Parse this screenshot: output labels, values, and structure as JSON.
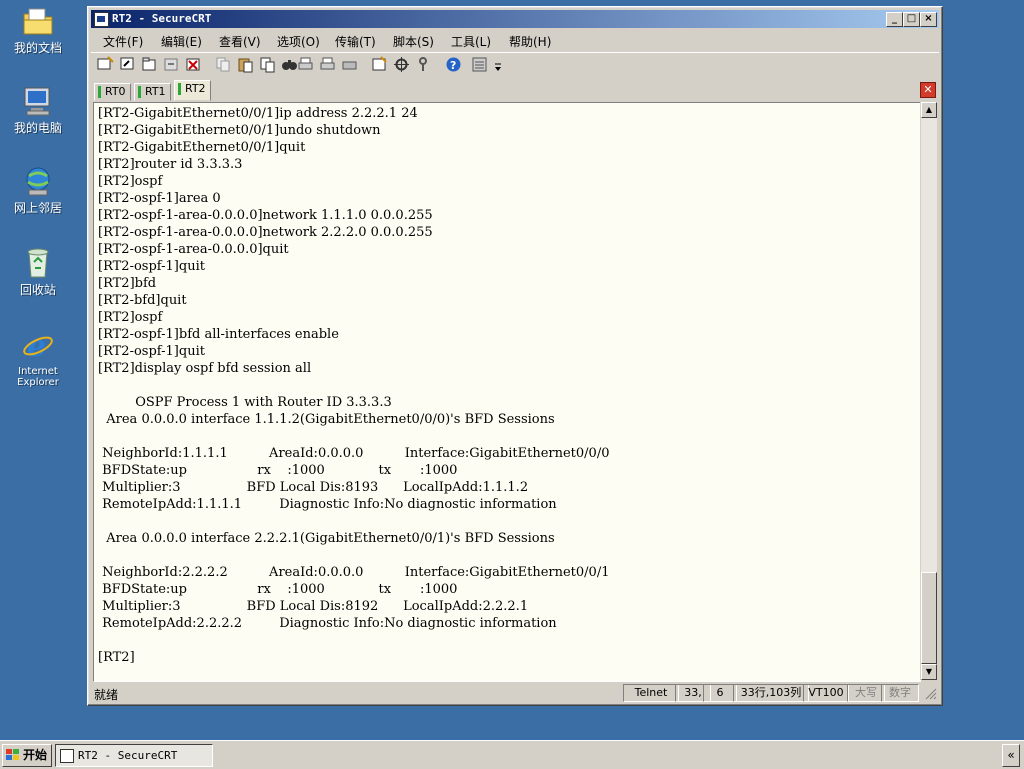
{
  "desktop": {
    "icons": [
      {
        "label": "我的文档",
        "icon": "my-documents-icon"
      },
      {
        "label": "我的电脑",
        "icon": "my-computer-icon"
      },
      {
        "label": "网上邻居",
        "icon": "network-places-icon"
      },
      {
        "label": "回收站",
        "icon": "recycle-bin-icon"
      },
      {
        "label": "Internet Explorer",
        "icon": "internet-explorer-icon"
      }
    ]
  },
  "window": {
    "title": "RT2 - SecureCRT",
    "controls": {
      "minimize": "_",
      "maximize": "□",
      "close": "×"
    }
  },
  "menu": [
    "文件(F)",
    "编辑(E)",
    "查看(V)",
    "选项(O)",
    "传输(T)",
    "脚本(S)",
    "工具(L)",
    "帮助(H)"
  ],
  "tabs": [
    {
      "label": "RT0",
      "active": false
    },
    {
      "label": "RT1",
      "active": false
    },
    {
      "label": "RT2",
      "active": true
    }
  ],
  "terminal": {
    "lines": [
      "[RT2-GigabitEthernet0/0/1]ip address 2.2.2.1 24",
      "[RT2-GigabitEthernet0/0/1]undo shutdown",
      "[RT2-GigabitEthernet0/0/1]quit",
      "[RT2]router id 3.3.3.3",
      "[RT2]ospf",
      "[RT2-ospf-1]area 0",
      "[RT2-ospf-1-area-0.0.0.0]network 1.1.1.0 0.0.0.255",
      "[RT2-ospf-1-area-0.0.0.0]network 2.2.2.0 0.0.0.255",
      "[RT2-ospf-1-area-0.0.0.0]quit",
      "[RT2-ospf-1]quit",
      "[RT2]bfd",
      "[RT2-bfd]quit",
      "[RT2]ospf",
      "[RT2-ospf-1]bfd all-interfaces enable",
      "[RT2-ospf-1]quit",
      "[RT2]display ospf bfd session all",
      "",
      "         OSPF Process 1 with Router ID 3.3.3.3",
      "  Area 0.0.0.0 interface 1.1.1.2(GigabitEthernet0/0/0)'s BFD Sessions",
      "",
      " NeighborId:1.1.1.1          AreaId:0.0.0.0          Interface:GigabitEthernet0/0/0",
      " BFDState:up                 rx    :1000             tx       :1000",
      " Multiplier:3                BFD Local Dis:8193      LocalIpAdd:1.1.1.2",
      " RemoteIpAdd:1.1.1.1         Diagnostic Info:No diagnostic information",
      "",
      "  Area 0.0.0.0 interface 2.2.2.1(GigabitEthernet0/0/1)'s BFD Sessions",
      "",
      " NeighborId:2.2.2.2          AreaId:0.0.0.0          Interface:GigabitEthernet0/0/1",
      " BFDState:up                 rx    :1000             tx       :1000",
      " Multiplier:3                BFD Local Dis:8192      LocalIpAdd:2.2.2.1",
      " RemoteIpAdd:2.2.2.2         Diagnostic Info:No diagnostic information",
      "",
      "[RT2]"
    ]
  },
  "status": {
    "ready": "就绪",
    "protocol": "Telnet",
    "row": "33,",
    "col": "6",
    "size": "33行,103列",
    "emulation": "VT100",
    "caps": "大写",
    "num": "数字"
  },
  "taskbar": {
    "start": "开始",
    "task": "RT2 - SecureCRT",
    "tray_toggle": "«"
  },
  "colors": {
    "desktop": "#3a6ea5",
    "title_start": "#0a246a",
    "title_end": "#a6caf0",
    "terminal_bg": "#fefdf3"
  }
}
